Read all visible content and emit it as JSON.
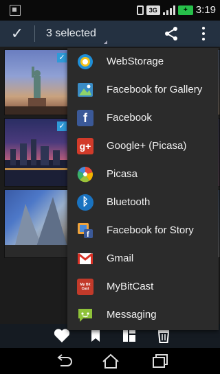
{
  "status_bar": {
    "network": "3G",
    "battery": "+",
    "time": "3:19"
  },
  "action_bar": {
    "selection_label": "3 selected"
  },
  "share_menu": {
    "items": [
      {
        "label": "WebStorage",
        "icon": "webstorage-icon",
        "color": "#1f8fd8"
      },
      {
        "label": "Facebook for Gallery",
        "icon": "facebook-gallery-icon",
        "color": "#3a8cc6"
      },
      {
        "label": "Facebook",
        "icon": "facebook-icon",
        "color": "#3b5998"
      },
      {
        "label": "Google+ (Picasa)",
        "icon": "google-plus-icon",
        "color": "#d23b2a"
      },
      {
        "label": "Picasa",
        "icon": "picasa-icon",
        "color": "#9bb53a"
      },
      {
        "label": "Bluetooth",
        "icon": "bluetooth-icon",
        "color": "#1a73c0"
      },
      {
        "label": "Facebook for Story",
        "icon": "facebook-story-icon",
        "color": "#3b5998"
      },
      {
        "label": "Gmail",
        "icon": "gmail-icon",
        "color": "#d93025"
      },
      {
        "label": "MyBitCast",
        "icon": "mybitcast-icon",
        "color": "#c23a2a"
      },
      {
        "label": "Messaging",
        "icon": "messaging-icon",
        "color": "#8fc23a"
      }
    ]
  },
  "icon_glyphs": {
    "facebook": "f",
    "google_plus": "g+",
    "bluetooth": "ᛒ",
    "mybitcast": "My Bit Cast"
  }
}
